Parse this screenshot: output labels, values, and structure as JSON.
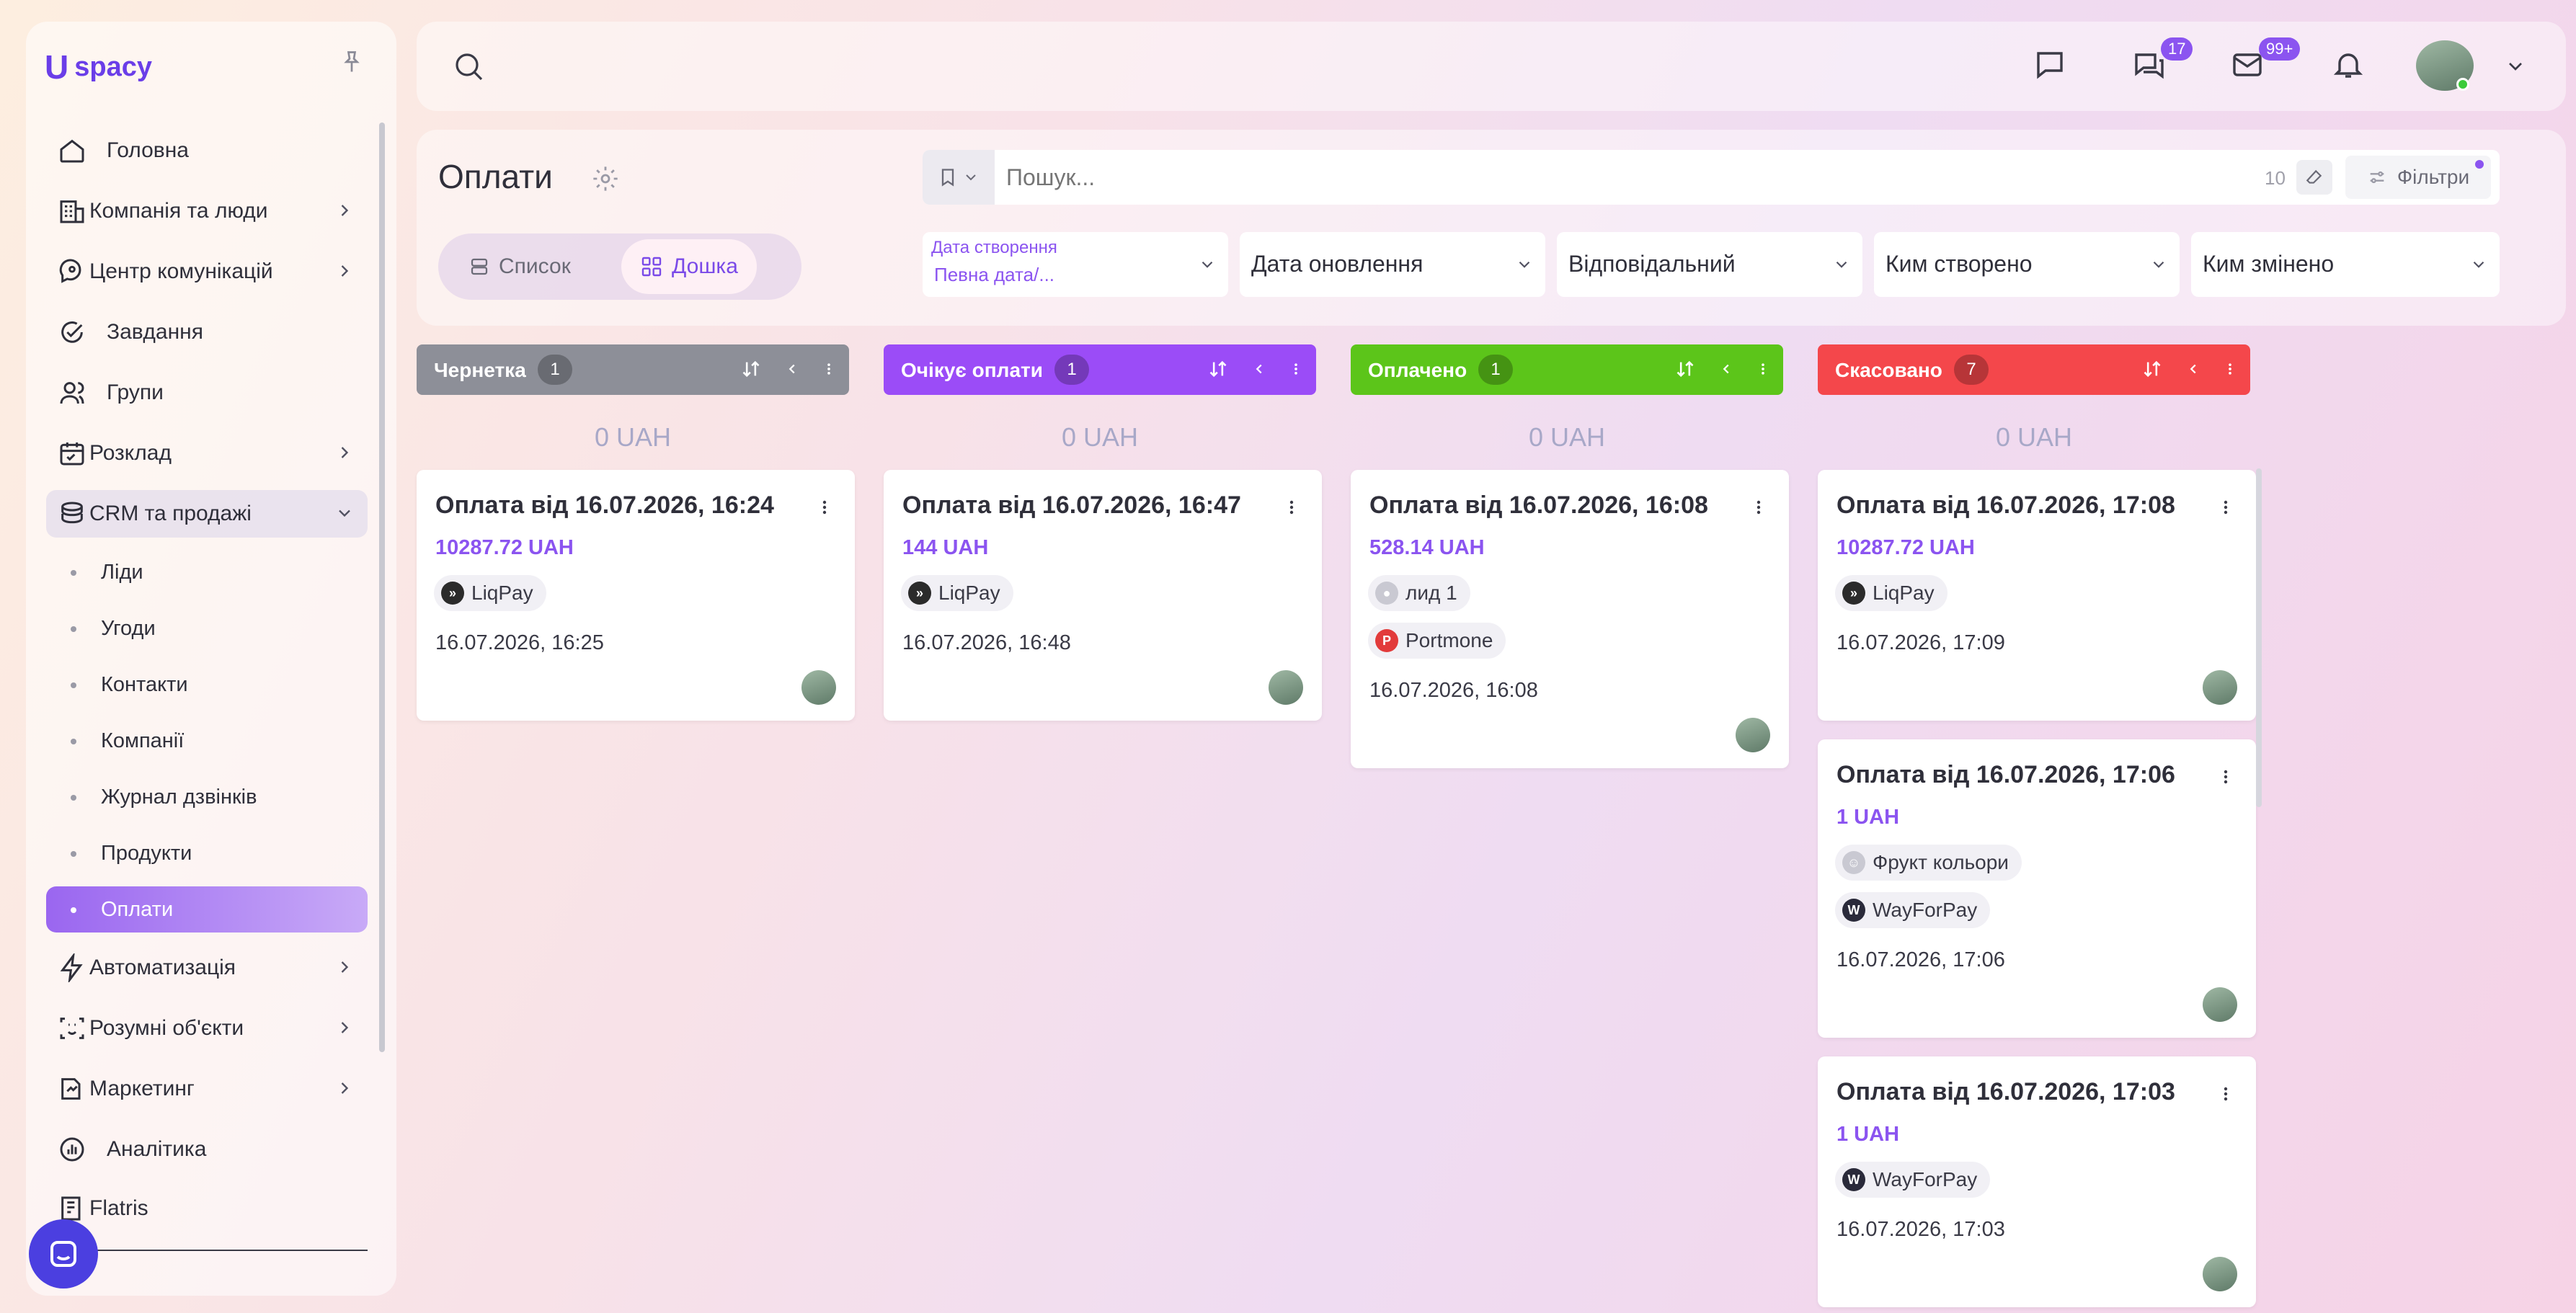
{
  "app": {
    "logo_mark": "U",
    "logo_text": "spacy"
  },
  "sidebar": {
    "items": [
      {
        "label": "Головна",
        "icon": "home-icon"
      },
      {
        "label": "Компанія та люди",
        "icon": "company-icon"
      },
      {
        "label": "Центр комунікацій",
        "icon": "communications-icon"
      },
      {
        "label": "Завдання",
        "icon": "tasks-icon"
      },
      {
        "label": "Групи",
        "icon": "groups-icon"
      },
      {
        "label": "Розклад",
        "icon": "calendar-icon"
      },
      {
        "label": "CRM та продажі",
        "icon": "crm-icon"
      },
      {
        "label": "Автоматизація",
        "icon": "automation-icon"
      },
      {
        "label": "Розумні об'єкти",
        "icon": "smart-objects-icon"
      },
      {
        "label": "Маркетинг",
        "icon": "marketing-icon"
      },
      {
        "label": "Аналітика",
        "icon": "analytics-icon"
      },
      {
        "label": "Flatris",
        "icon": "flatris-icon"
      }
    ],
    "crm_sub": [
      "Ліди",
      "Угоди",
      "Контакти",
      "Компанії",
      "Журнал дзвінків",
      "Продукти",
      "Оплати"
    ]
  },
  "topbar": {
    "chat_badge": "17",
    "mail_badge": "99+"
  },
  "page": {
    "title": "Оплати",
    "view_list": "Список",
    "view_board": "Дошка"
  },
  "search": {
    "placeholder": "Пошук...",
    "count": "10",
    "filters_label": "Фільтри"
  },
  "filters": [
    {
      "label": "Дата створення",
      "value": "Певна дата/..."
    },
    {
      "label": "Дата оновлення"
    },
    {
      "label": "Відповідальний"
    },
    {
      "label": "Ким створено"
    },
    {
      "label": "Ким змінено"
    }
  ],
  "columns": [
    {
      "name": "Чернетка",
      "count": "1",
      "sum": "0 UAH",
      "color": "#8d8f98",
      "cards": [
        {
          "title": "Оплата від 16.07.2026, 16:24",
          "amount": "10287.72 UAH",
          "chips": [
            {
              "label": "LiqPay",
              "icon": "liqpay-icon"
            }
          ],
          "date": "16.07.2026, 16:25"
        }
      ]
    },
    {
      "name": "Очікує оплати",
      "count": "1",
      "sum": "0 UAH",
      "color": "#9b4cf7",
      "cards": [
        {
          "title": "Оплата від 16.07.2026, 16:47",
          "amount": "144 UAH",
          "chips": [
            {
              "label": "LiqPay",
              "icon": "liqpay-icon"
            }
          ],
          "date": "16.07.2026, 16:48"
        }
      ]
    },
    {
      "name": "Оплачено",
      "count": "1",
      "sum": "0 UAH",
      "color": "#5cc51a",
      "cards": [
        {
          "title": "Оплата від 16.07.2026, 16:08",
          "amount": "528.14 UAH",
          "chips": [
            {
              "label": "лид 1",
              "icon": "lead-icon"
            },
            {
              "label": "Portmone",
              "icon": "portmone-icon"
            }
          ],
          "date": "16.07.2026, 16:08"
        }
      ]
    },
    {
      "name": "Скасовано",
      "count": "7",
      "sum": "0 UAH",
      "color": "#f4474b",
      "cards": [
        {
          "title": "Оплата від 16.07.2026, 17:08",
          "amount": "10287.72 UAH",
          "chips": [
            {
              "label": "LiqPay",
              "icon": "liqpay-icon"
            }
          ],
          "date": "16.07.2026, 17:09"
        },
        {
          "title": "Оплата від 16.07.2026, 17:06",
          "amount": "1 UAH",
          "chips": [
            {
              "label": "Фрукт кольори",
              "icon": "contact-icon"
            },
            {
              "label": "WayForPay",
              "icon": "wayforpay-icon"
            }
          ],
          "date": "16.07.2026, 17:06"
        },
        {
          "title": "Оплата від 16.07.2026, 17:03",
          "amount": "1 UAH",
          "chips": [
            {
              "label": "WayForPay",
              "icon": "wayforpay-icon"
            }
          ],
          "date": "16.07.2026, 17:03"
        }
      ]
    }
  ]
}
